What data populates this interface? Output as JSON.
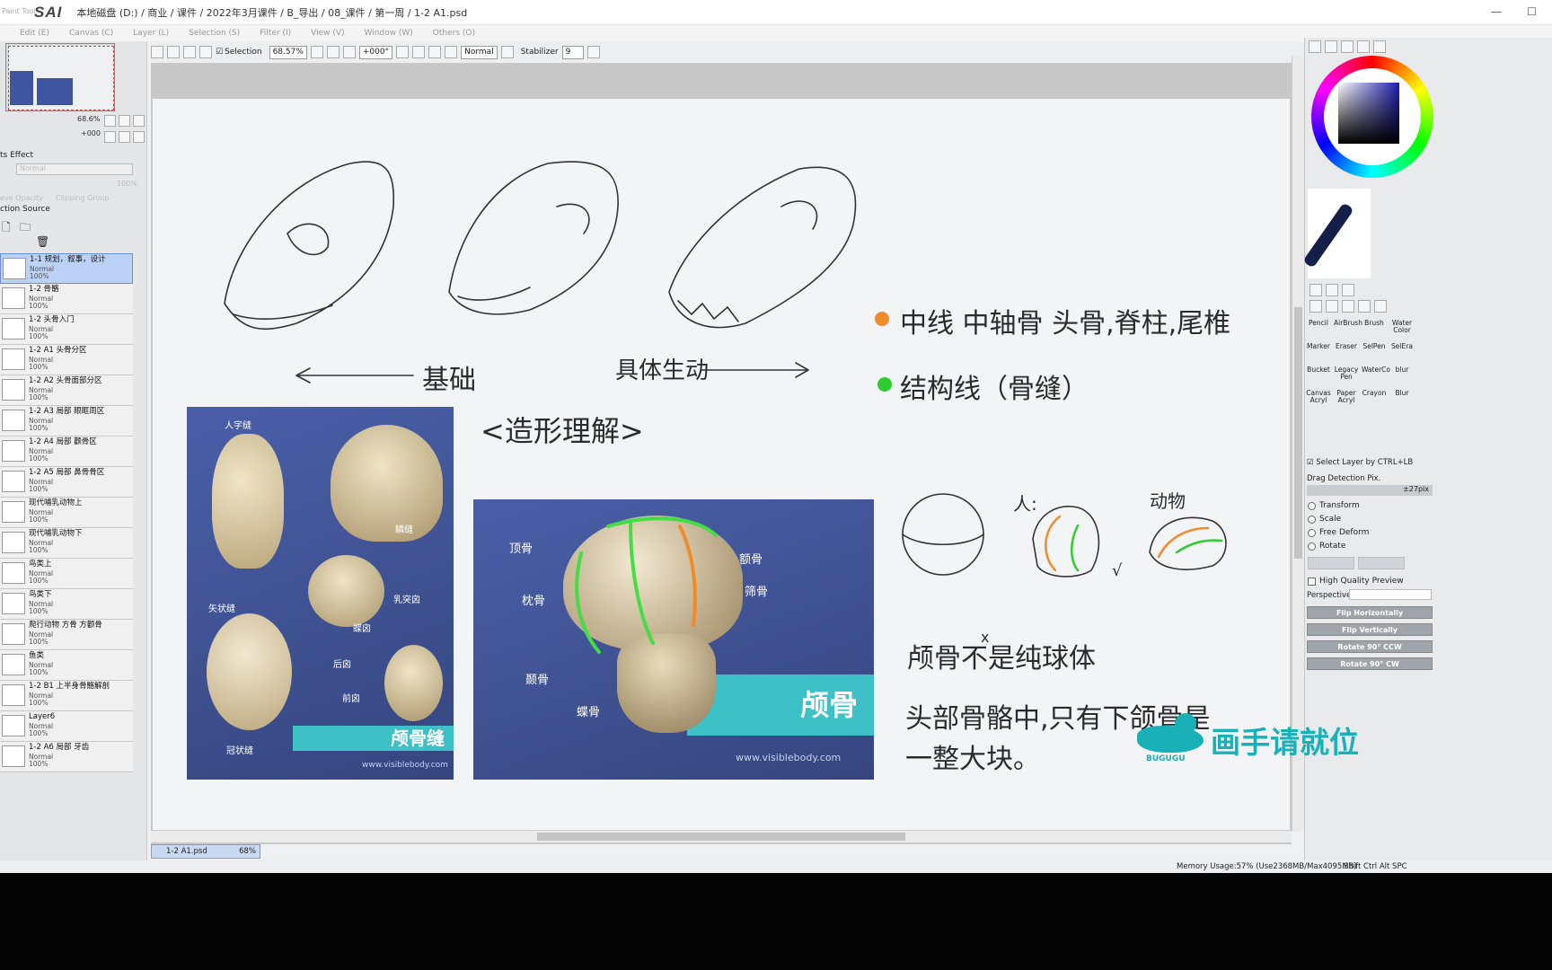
{
  "app": {
    "logo": "SAI",
    "logo_prefix": "Paint Tool",
    "path": "本地磁盘 (D:) / 商业 / 课件 / 2022年3月课件 / B_导出 / 08_课件 / 第一周 / 1-2 A1.psd"
  },
  "menu": [
    "Edit (E)",
    "Canvas (C)",
    "Layer (L)",
    "Selection (S)",
    "Filter (I)",
    "View (V)",
    "Window (W)",
    "Others (O)"
  ],
  "toolbar": {
    "selection_label": "Selection",
    "zoom": "68.57%",
    "angle": "+000°",
    "blend": "Normal",
    "stabilizer_label": "Stabilizer",
    "stabilizer_value": "9"
  },
  "navigator": {
    "zoom": "68.6%",
    "angle": "+000"
  },
  "layer_props": {
    "effect_label": "ts Effect",
    "mode": "Normal",
    "opacity": "100%",
    "protect": "eve Opacity",
    "clipping": "Clipping Group",
    "source": "ction Source"
  },
  "layers": [
    {
      "name": "1-1 规划，叙事，设计",
      "mode": "Normal",
      "opacity": "100%",
      "selected": true
    },
    {
      "name": "1-2 骨骼",
      "mode": "Normal",
      "opacity": "100%"
    },
    {
      "name": "1-2 头骨入门",
      "mode": "Normal",
      "opacity": "100%"
    },
    {
      "name": "1-2 A1 头骨分区",
      "mode": "Normal",
      "opacity": "100%"
    },
    {
      "name": "1-2 A2 头骨面部分区",
      "mode": "Normal",
      "opacity": "100%"
    },
    {
      "name": "1-2 A3 局部 眼眶周区",
      "mode": "Normal",
      "opacity": "100%"
    },
    {
      "name": "1-2 A4 局部 颧骨区",
      "mode": "Normal",
      "opacity": "100%"
    },
    {
      "name": "1-2 A5 局部 鼻骨骨区",
      "mode": "Normal",
      "opacity": "100%"
    },
    {
      "name": "现代哺乳动物上",
      "mode": "Normal",
      "opacity": "100%"
    },
    {
      "name": "现代哺乳动物下",
      "mode": "Normal",
      "opacity": "100%"
    },
    {
      "name": "鸟类上",
      "mode": "Normal",
      "opacity": "100%"
    },
    {
      "name": "鸟类下",
      "mode": "Normal",
      "opacity": "100%"
    },
    {
      "name": "爬行动物 方骨 方颧骨",
      "mode": "Normal",
      "opacity": "100%"
    },
    {
      "name": "鱼类",
      "mode": "Normal",
      "opacity": "100%"
    },
    {
      "name": "1-2 B1 上半身骨骼解剖",
      "mode": "Normal",
      "opacity": "100%"
    },
    {
      "name": "Layer6",
      "mode": "Normal",
      "opacity": "100%"
    },
    {
      "name": "1-2 A6 局部 牙齿",
      "mode": "Normal",
      "opacity": "100%"
    }
  ],
  "canvas": {
    "arrow_left": "基础",
    "arrow_right": "具体生动",
    "heading": "<造形理解>",
    "bullet1": "中线  中轴骨 头骨,脊柱,尾椎",
    "bullet2": "结构线（骨缝）",
    "note1": "颅骨不是纯球体",
    "note2": "头部骨骼中,只有下颌骨是",
    "note3": "一整大块。",
    "sketch_x": "x",
    "sketch_check": "√",
    "sketch_human": "人:",
    "sketch_animal": "动物",
    "colors": {
      "orange": "#f08a2a",
      "green": "#2ecc2e"
    },
    "img1": {
      "caption": "颅骨缝",
      "url": "www.visiblebody.com",
      "labels": [
        "人字缝",
        "鳞缝",
        "乳突囟",
        "蝶囟",
        "矢状缝",
        "后囟",
        "前囟",
        "冠状缝"
      ]
    },
    "img2": {
      "caption": "颅骨",
      "url": "www.visiblebody.com",
      "labels": [
        "顶骨",
        "额骨",
        "枕骨",
        "筛骨",
        "颞骨",
        "蝶骨"
      ]
    }
  },
  "right_panel": {
    "tools": [
      [
        "Pencil",
        "AirBrush",
        "Brush",
        "Water Color"
      ],
      [
        "Marker",
        "Eraser",
        "SelPen",
        "SelEra"
      ],
      [
        "Bucket",
        "Legacy Pen",
        "WaterCo",
        "blur"
      ],
      [
        "Canvas Acryl",
        "Paper Acryl",
        "Crayon",
        "Blur"
      ]
    ],
    "select_layer": "Select Layer by CTRL+LB",
    "drag_detect": "Drag Detection Pix.",
    "drag_value": "±27pix",
    "radios": [
      "Transform",
      "Scale",
      "Free Deform",
      "Rotate"
    ],
    "hq_preview": "High Quality Preview",
    "perspective": "Perspective",
    "buttons": [
      "Flip Horizontally",
      "Flip Vertically",
      "Rotate 90° CCW",
      "Rotate 90° CW"
    ]
  },
  "status": {
    "tab": "1-2 A1.psd",
    "tab_zoom": "68%",
    "memory": "Memory Usage:57% (Use2368MB/Max4095MB)",
    "keys": "Shift Ctrl Alt SPC"
  },
  "watermark": {
    "text": "画手请就位",
    "sub": "BUGUGU"
  }
}
